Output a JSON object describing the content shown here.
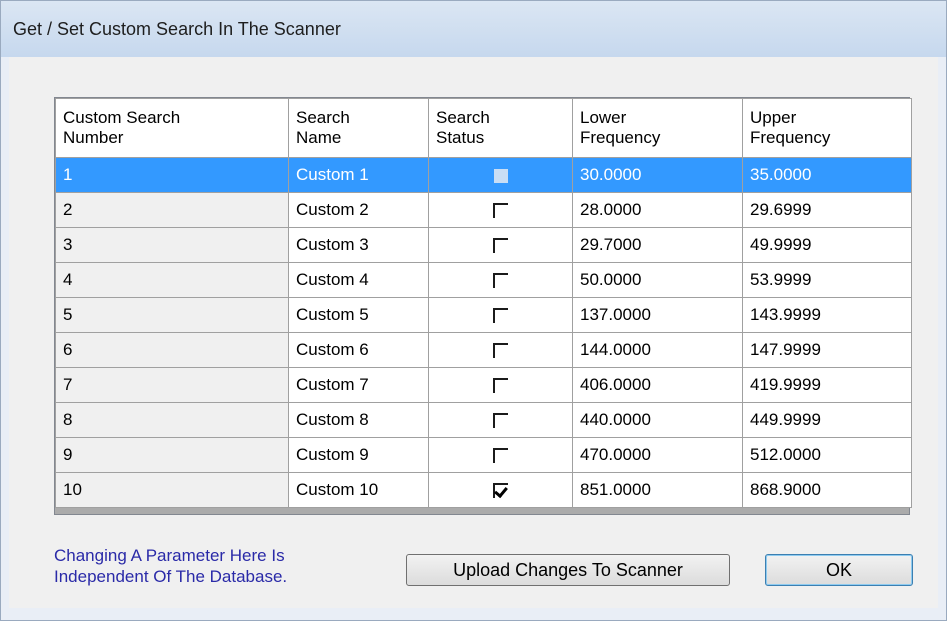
{
  "window": {
    "title": "Get / Set Custom Search In The Scanner"
  },
  "grid": {
    "columns": [
      {
        "line1": "Custom Search",
        "line2": "Number"
      },
      {
        "line1": "Search",
        "line2": "Name"
      },
      {
        "line1": "Search",
        "line2": "Status"
      },
      {
        "line1": "Lower",
        "line2": "Frequency"
      },
      {
        "line1": "Upper",
        "line2": "Frequency"
      }
    ],
    "rows": [
      {
        "num": "1",
        "name": "Custom 1",
        "status": "unchecked",
        "lower": "30.0000",
        "upper": "35.0000",
        "selected": true
      },
      {
        "num": "2",
        "name": "Custom 2",
        "status": "unchecked",
        "lower": "28.0000",
        "upper": "29.6999"
      },
      {
        "num": "3",
        "name": "Custom 3",
        "status": "unchecked",
        "lower": "29.7000",
        "upper": "49.9999"
      },
      {
        "num": "4",
        "name": "Custom 4",
        "status": "unchecked",
        "lower": "50.0000",
        "upper": "53.9999"
      },
      {
        "num": "5",
        "name": "Custom 5",
        "status": "unchecked",
        "lower": "137.0000",
        "upper": "143.9999"
      },
      {
        "num": "6",
        "name": "Custom 6",
        "status": "unchecked",
        "lower": "144.0000",
        "upper": "147.9999"
      },
      {
        "num": "7",
        "name": "Custom 7",
        "status": "unchecked",
        "lower": "406.0000",
        "upper": "419.9999"
      },
      {
        "num": "8",
        "name": "Custom 8",
        "status": "unchecked",
        "lower": "440.0000",
        "upper": "449.9999"
      },
      {
        "num": "9",
        "name": "Custom 9",
        "status": "unchecked",
        "lower": "470.0000",
        "upper": "512.0000"
      },
      {
        "num": "10",
        "name": "Custom 10",
        "status": "checked",
        "lower": "851.0000",
        "upper": "868.9000"
      }
    ]
  },
  "footer": {
    "note_line1": "Changing A Parameter Here Is",
    "note_line2": "Independent Of The Database.",
    "upload_label": "Upload Changes To Scanner",
    "ok_label": "OK"
  },
  "colors": {
    "selection": "#3399ff",
    "note_text": "#2a2aa8"
  }
}
